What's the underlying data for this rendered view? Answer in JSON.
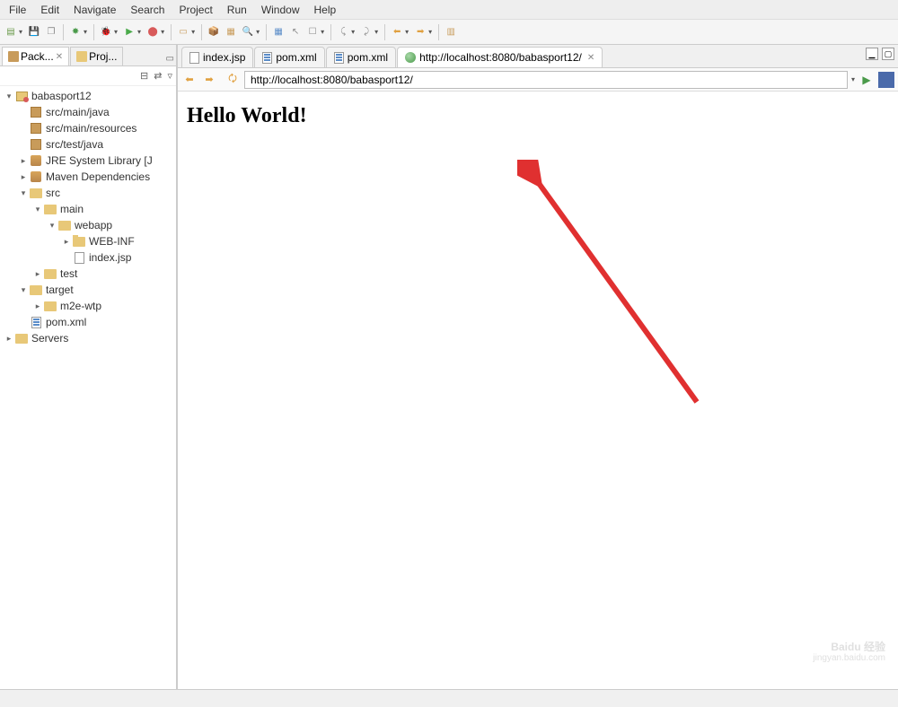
{
  "menu": {
    "items": [
      "File",
      "Edit",
      "Navigate",
      "Search",
      "Project",
      "Run",
      "Window",
      "Help"
    ]
  },
  "sidebar": {
    "tabs": [
      {
        "label": "Pack...",
        "active": true
      },
      {
        "label": "Proj...",
        "active": false
      }
    ]
  },
  "tree": [
    {
      "depth": 0,
      "arrow": "▾",
      "icon": "project",
      "label": "babasport12"
    },
    {
      "depth": 1,
      "arrow": "",
      "icon": "package",
      "label": "src/main/java"
    },
    {
      "depth": 1,
      "arrow": "",
      "icon": "package",
      "label": "src/main/resources"
    },
    {
      "depth": 1,
      "arrow": "",
      "icon": "package",
      "label": "src/test/java"
    },
    {
      "depth": 1,
      "arrow": "▸",
      "icon": "jar",
      "label": "JRE System Library [J"
    },
    {
      "depth": 1,
      "arrow": "▸",
      "icon": "jar",
      "label": "Maven Dependencies"
    },
    {
      "depth": 1,
      "arrow": "▾",
      "icon": "folder",
      "label": "src"
    },
    {
      "depth": 2,
      "arrow": "▾",
      "icon": "folder",
      "label": "main"
    },
    {
      "depth": 3,
      "arrow": "▾",
      "icon": "folder",
      "label": "webapp"
    },
    {
      "depth": 4,
      "arrow": "▸",
      "icon": "folder-open",
      "label": "WEB-INF"
    },
    {
      "depth": 4,
      "arrow": "",
      "icon": "file",
      "label": "index.jsp"
    },
    {
      "depth": 2,
      "arrow": "▸",
      "icon": "folder",
      "label": "test"
    },
    {
      "depth": 1,
      "arrow": "▾",
      "icon": "folder",
      "label": "target"
    },
    {
      "depth": 2,
      "arrow": "▸",
      "icon": "folder",
      "label": "m2e-wtp"
    },
    {
      "depth": 1,
      "arrow": "",
      "icon": "xml",
      "label": "pom.xml"
    },
    {
      "depth": 0,
      "arrow": "▸",
      "icon": "folder",
      "label": "Servers"
    }
  ],
  "editor": {
    "tabs": [
      {
        "icon": "file",
        "label": "index.jsp",
        "active": false
      },
      {
        "icon": "xml",
        "label": "pom.xml",
        "active": false
      },
      {
        "icon": "xml",
        "label": "pom.xml",
        "active": false
      },
      {
        "icon": "globe",
        "label": "http://localhost:8080/babasport12/",
        "active": true
      }
    ],
    "url": "http://localhost:8080/babasport12/"
  },
  "page": {
    "heading": "Hello World!"
  },
  "watermark": {
    "main": "Baidu 经验",
    "sub": "jingyan.baidu.com"
  }
}
